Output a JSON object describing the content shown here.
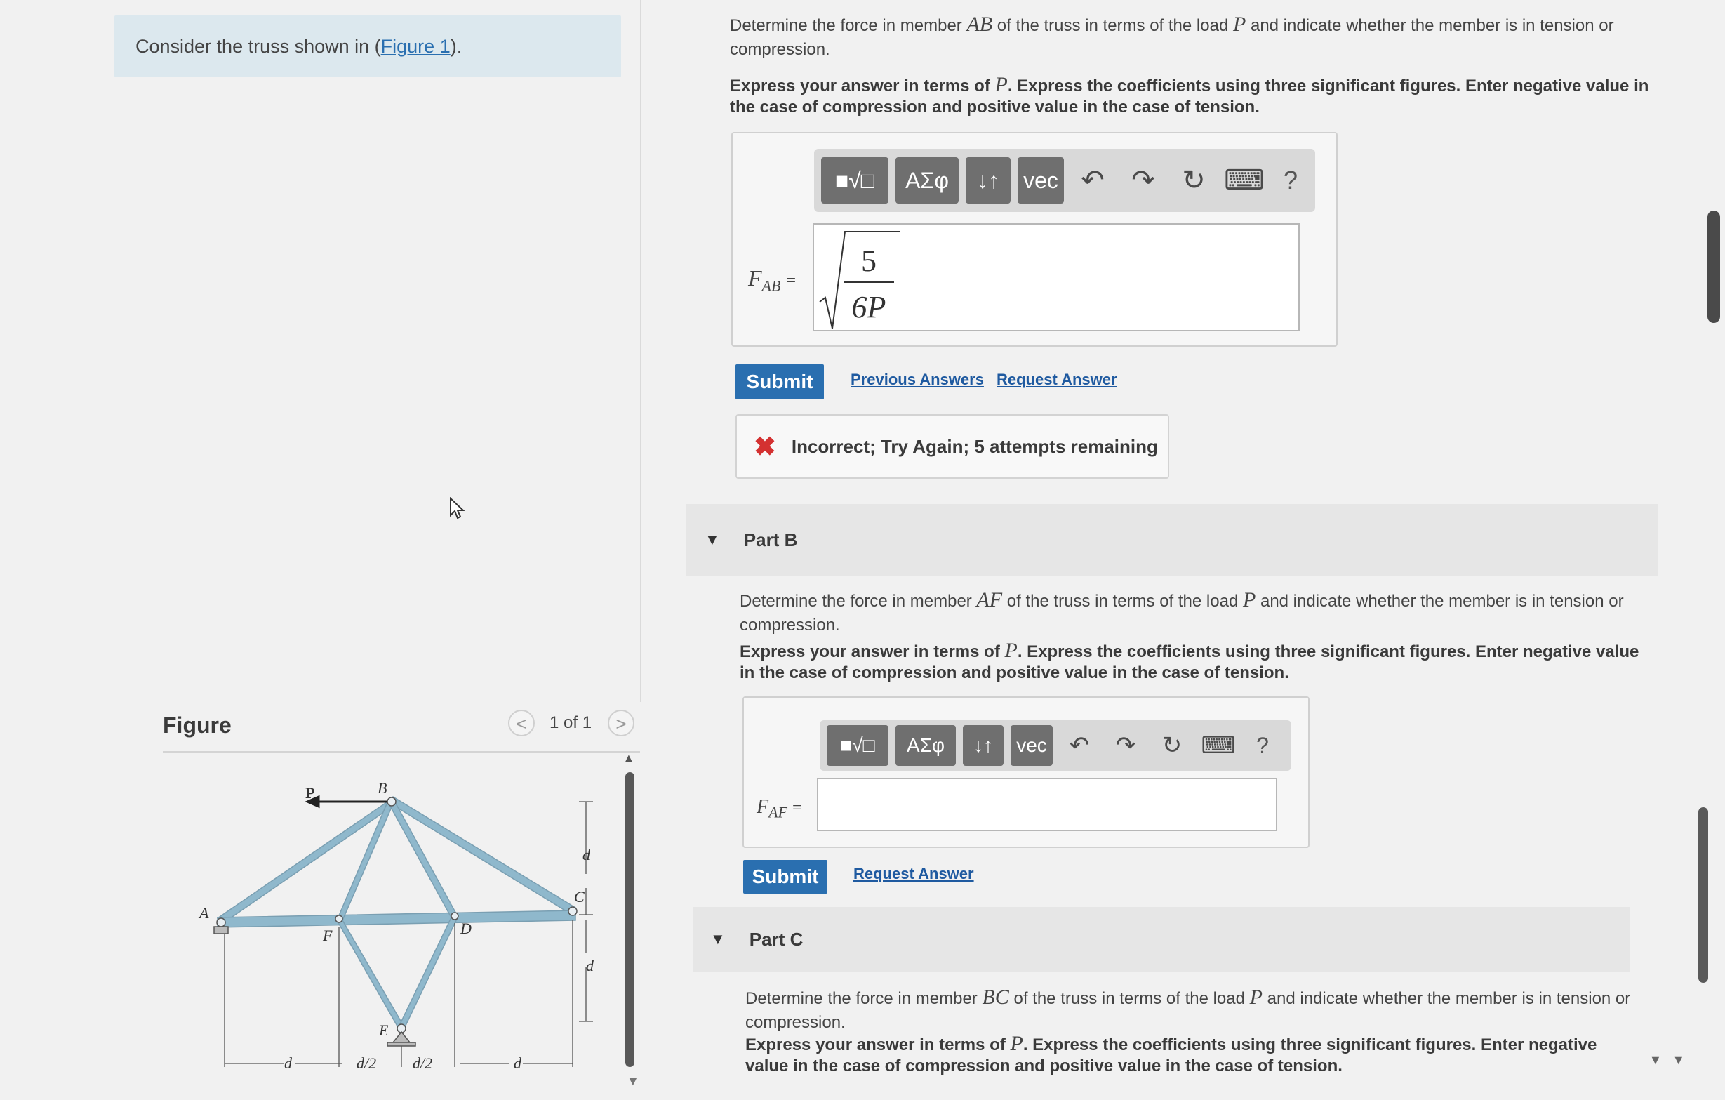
{
  "intro": {
    "text_before": "Consider the truss shown in (",
    "link": "Figure 1",
    "text_after": ")."
  },
  "figure": {
    "title": "Figure",
    "pager": {
      "prev": "<",
      "label": "1 of 1",
      "next": ">"
    },
    "labels": {
      "P": "P",
      "A": "A",
      "B": "B",
      "C": "C",
      "D": "D",
      "E": "E",
      "F": "F",
      "d": "d",
      "d_half": "d/2"
    }
  },
  "partA": {
    "q_pre": "Determine the force in member ",
    "q_member": "AB",
    "q_mid": " of the truss in terms of the load ",
    "q_load": "P",
    "q_post": " and indicate whether the member is in tension or compression.",
    "instr_pre": "Express your answer in terms of ",
    "instr_var": "P",
    "instr_post": ". Express the coefficients using three significant figures. Enter negative value in the case of compression and positive value in the case of tension.",
    "answer_var": "F",
    "answer_sub": "AB",
    "eq": "=",
    "answer_num": "5",
    "answer_den": "6P",
    "submit": "Submit",
    "previous_answers": "Previous Answers",
    "request_answer": "Request Answer",
    "feedback_icon": "✖",
    "feedback": "Incorrect; Try Again; 5 attempts remaining"
  },
  "toolbar": {
    "templates": "■√□",
    "greek": "ΑΣφ",
    "arrows": "↓↑",
    "vec": "vec",
    "undo": "↶",
    "redo": "↷",
    "reset": "↻",
    "keyboard": "⌨",
    "help": "?"
  },
  "partB": {
    "header": "Part B",
    "q_pre": "Determine the force in member ",
    "q_member": "AF",
    "q_mid": " of the truss in terms of the load ",
    "q_load": "P",
    "q_post": " and indicate whether the member is in tension or compression.",
    "instr_pre": "Express your answer in terms of ",
    "instr_var": "P",
    "instr_post": ". Express the coefficients using three significant figures. Enter negative value in the case of compression and positive value in the case of tension.",
    "answer_var": "F",
    "answer_sub": "AF",
    "eq": "=",
    "submit": "Submit",
    "request_answer": "Request Answer"
  },
  "partC": {
    "header": "Part C",
    "q_pre": "Determine the force in member ",
    "q_member": "BC",
    "q_mid": " of the truss in terms of the load ",
    "q_load": "P",
    "q_post": " and indicate whether the member is in tension or compression.",
    "instr_pre": "Express your answer in terms of ",
    "instr_var": "P",
    "instr_post": ". Express the coefficients using three significant figures. Enter negative value in the case of compression and positive value in the case of tension."
  },
  "colors": {
    "intro_bg": "#dce8ee",
    "submit_bg": "#2a6fb0",
    "link": "#1f5aa0",
    "error": "#d43131",
    "truss_member": "#8fb8cc"
  }
}
